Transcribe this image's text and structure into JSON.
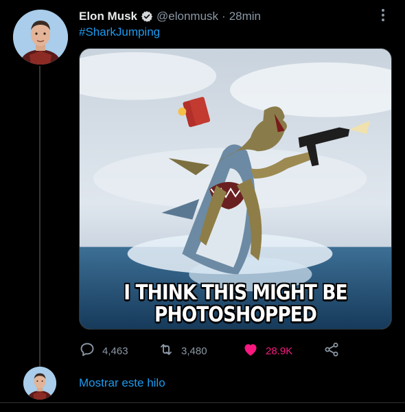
{
  "tweet": {
    "author_name": "Elon Musk",
    "handle": "@elonmusk",
    "separator": "·",
    "time": "28min",
    "text": "#SharkJumping",
    "media": {
      "caption_line1": "I THINK THIS MIGHT BE",
      "caption_line2": "PHOTOSHOPPED"
    },
    "actions": {
      "replies": "4,463",
      "retweets": "3,480",
      "likes": "28.9K",
      "liked": true
    }
  },
  "thread": {
    "show_thread_label": "Mostrar este hilo"
  },
  "icons": {
    "verified": "verified-badge-icon",
    "more": "more-options-icon",
    "reply": "reply-bubble-icon",
    "retweet": "retweet-icon",
    "like": "heart-icon",
    "share": "share-icon"
  },
  "colors": {
    "background": "#000000",
    "link": "#1d9bf0",
    "muted": "#8b98a5",
    "like": "#f91880",
    "text": "#e7e9ea"
  }
}
